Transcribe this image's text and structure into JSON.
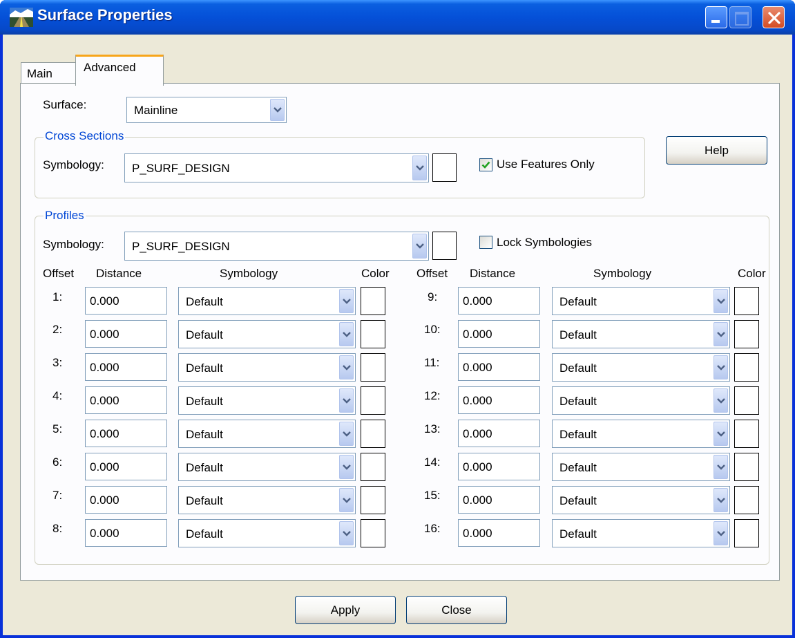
{
  "window": {
    "title": "Surface Properties"
  },
  "tabs": {
    "main": "Main",
    "advanced": "Advanced"
  },
  "surface": {
    "label": "Surface:",
    "value": "Mainline"
  },
  "cross_sections": {
    "title": "Cross Sections",
    "symbology_label": "Symbology:",
    "symbology_value": "P_SURF_DESIGN",
    "use_features_only": {
      "label": "Use Features Only",
      "checked": true
    }
  },
  "profiles": {
    "title": "Profiles",
    "symbology_label": "Symbology:",
    "symbology_value": "P_SURF_DESIGN",
    "lock_symbologies": {
      "label": "Lock Symbologies",
      "checked": false
    },
    "headers": {
      "offset": "Offset",
      "distance": "Distance",
      "symbology": "Symbology",
      "color": "Color"
    },
    "offsets_left": [
      {
        "label": "1:",
        "distance": "0.000",
        "symbology": "Default"
      },
      {
        "label": "2:",
        "distance": "0.000",
        "symbology": "Default"
      },
      {
        "label": "3:",
        "distance": "0.000",
        "symbology": "Default"
      },
      {
        "label": "4:",
        "distance": "0.000",
        "symbology": "Default"
      },
      {
        "label": "5:",
        "distance": "0.000",
        "symbology": "Default"
      },
      {
        "label": "6:",
        "distance": "0.000",
        "symbology": "Default"
      },
      {
        "label": "7:",
        "distance": "0.000",
        "symbology": "Default"
      },
      {
        "label": "8:",
        "distance": "0.000",
        "symbology": "Default"
      }
    ],
    "offsets_right": [
      {
        "label": "9:",
        "distance": "0.000",
        "symbology": "Default"
      },
      {
        "label": "10:",
        "distance": "0.000",
        "symbology": "Default"
      },
      {
        "label": "11:",
        "distance": "0.000",
        "symbology": "Default"
      },
      {
        "label": "12:",
        "distance": "0.000",
        "symbology": "Default"
      },
      {
        "label": "13:",
        "distance": "0.000",
        "symbology": "Default"
      },
      {
        "label": "14:",
        "distance": "0.000",
        "symbology": "Default"
      },
      {
        "label": "15:",
        "distance": "0.000",
        "symbology": "Default"
      },
      {
        "label": "16:",
        "distance": "0.000",
        "symbology": "Default"
      }
    ]
  },
  "buttons": {
    "help": "Help",
    "apply": "Apply",
    "close": "Close"
  },
  "colors": {
    "titlebar": "#0550d8",
    "group_title": "#0046d5",
    "tab_highlight": "#f7a51a",
    "dialog_bg": "#ece9d8"
  }
}
